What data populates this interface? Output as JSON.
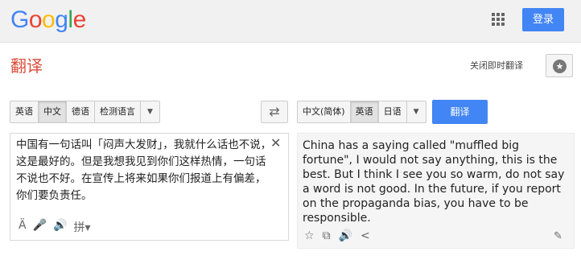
{
  "header": {
    "logo": [
      "G",
      "o",
      "o",
      "g",
      "l",
      "e"
    ],
    "login_label": "登录"
  },
  "page": {
    "title": "翻译",
    "instant_label": "关闭即时翻译"
  },
  "source_langs": [
    "英语",
    "中文",
    "德语",
    "检测语言"
  ],
  "target_langs": [
    "中文(简体)",
    "英语",
    "日语"
  ],
  "translate_label": "翻译",
  "source": {
    "text": "中国有一句话叫「闷声大发财」，我就什么话也不说，这是最好的。但是我想我见到你们这样热情，一句话不说也不好。在宣传上将来如果你们报道上有偏差，你们要负责任。",
    "clear": "✕",
    "tools": {
      "tts": "Ä",
      "mic": "🎤",
      "speaker": "🔊",
      "pinyin": "拼▾"
    }
  },
  "target": {
    "text": "China has a saying called \"muffled big fortune\", I would not say anything, this is the best. But I think I see you so warm, do not say a word is not good. In the future, if you report on the propaganda bias, you have to be responsible.",
    "tools": {
      "star": "☆",
      "copy": "⧉",
      "speaker": "🔊",
      "share": "<",
      "edit": "✎"
    }
  }
}
